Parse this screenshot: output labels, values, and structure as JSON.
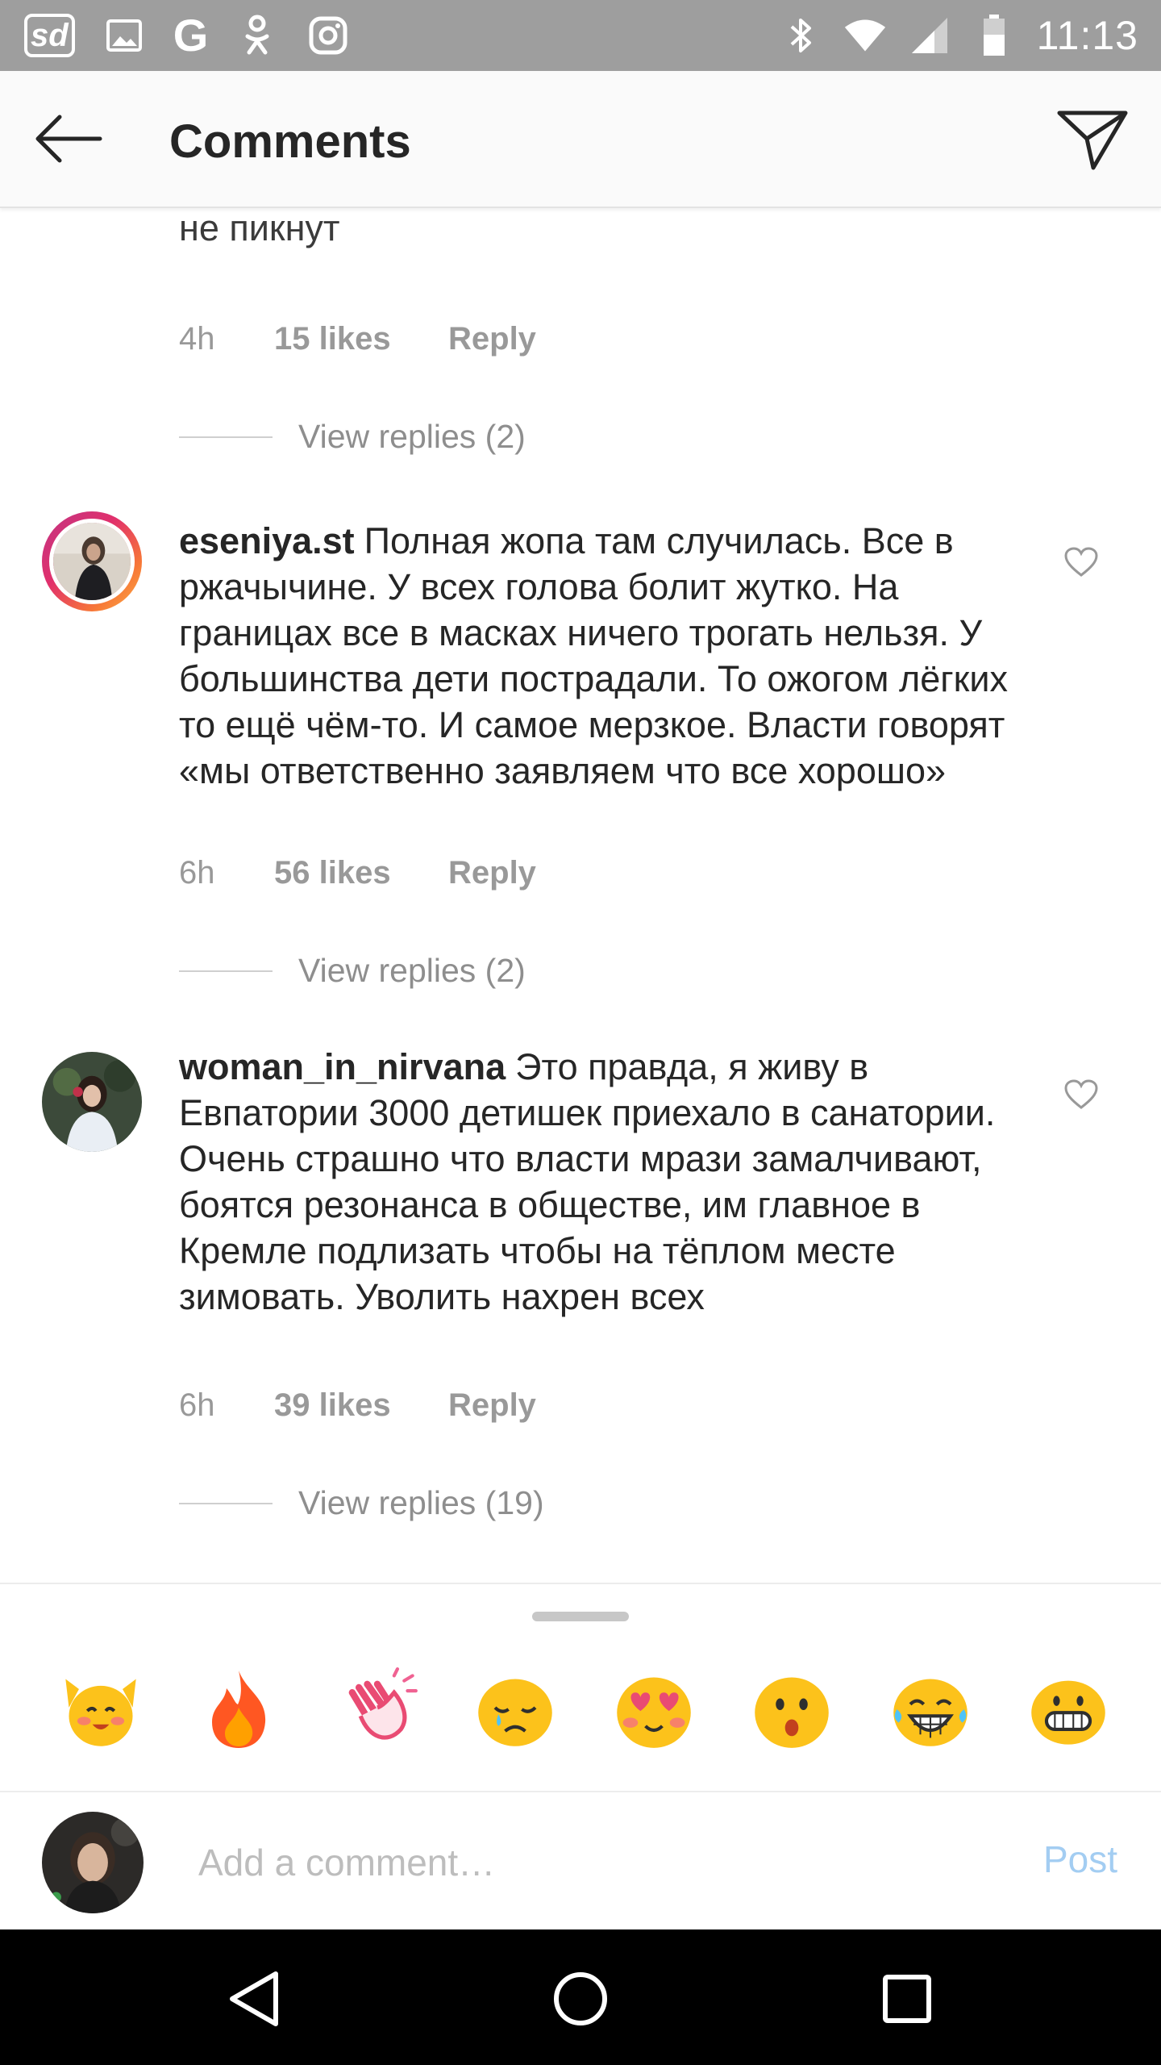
{
  "status_bar": {
    "time": "11:13",
    "left_icons": [
      "sd-app-icon",
      "gallery-icon",
      "google-icon",
      "odnoklassniki-icon",
      "instagram-icon"
    ],
    "right_icons": [
      "bluetooth-icon",
      "wifi-icon",
      "signal-icon",
      "battery-icon"
    ],
    "sd_label": "sd",
    "g_label": "G"
  },
  "header": {
    "title": "Comments",
    "back_icon": "arrow-left-icon",
    "share_icon": "send-icon"
  },
  "comments": [
    {
      "username": "",
      "text": "собирать можем, соседи подыхать будут СМИ и не пикнут",
      "time": "4h",
      "likes": "15 likes",
      "reply": "Reply",
      "view_replies": "View replies (2)"
    },
    {
      "username": "eseniya.st",
      "text": "Полная жопа там случилась. Все в ржачычине. У всех голова болит жутко. На границах все в масках ничего трогать нельзя. У большинства дети пострадали. То ожогом лёгких то ещё чём-то. И самое мерзкое. Власти говорят «мы ответственно заявляем что все хорошо»",
      "time": "6h",
      "likes": "56 likes",
      "reply": "Reply",
      "view_replies": "View replies (2)"
    },
    {
      "username": "woman_in_nirvana",
      "text": "Это правда, я живу в Евпатории 3000 детишек приехало в санатории. Очень страшно что власти мрази замалчивают, боятся резонанса в обществе, им главное в Кремле подлизать чтобы на тёплом месте зимовать. Уволить нахрен всех",
      "time": "6h",
      "likes": "39 likes",
      "reply": "Reply",
      "view_replies": "View replies (19)"
    }
  ],
  "emoji_bar": {
    "emojis": [
      "raising-hands-emoji",
      "fire-emoji",
      "clapping-hands-emoji",
      "crying-face-emoji",
      "heart-eyes-emoji",
      "surprised-face-emoji",
      "tears-of-joy-emoji",
      "grinning-face-emoji"
    ]
  },
  "composer": {
    "placeholder": "Add a comment…",
    "post_label": "Post"
  },
  "nav_bar": {
    "buttons": [
      "back-triangle-icon",
      "home-circle-icon",
      "recents-square-icon"
    ]
  },
  "colors": {
    "status_bar": "#9e9e9e",
    "post_button": "#a3cdf2",
    "meta_text": "#999999"
  }
}
